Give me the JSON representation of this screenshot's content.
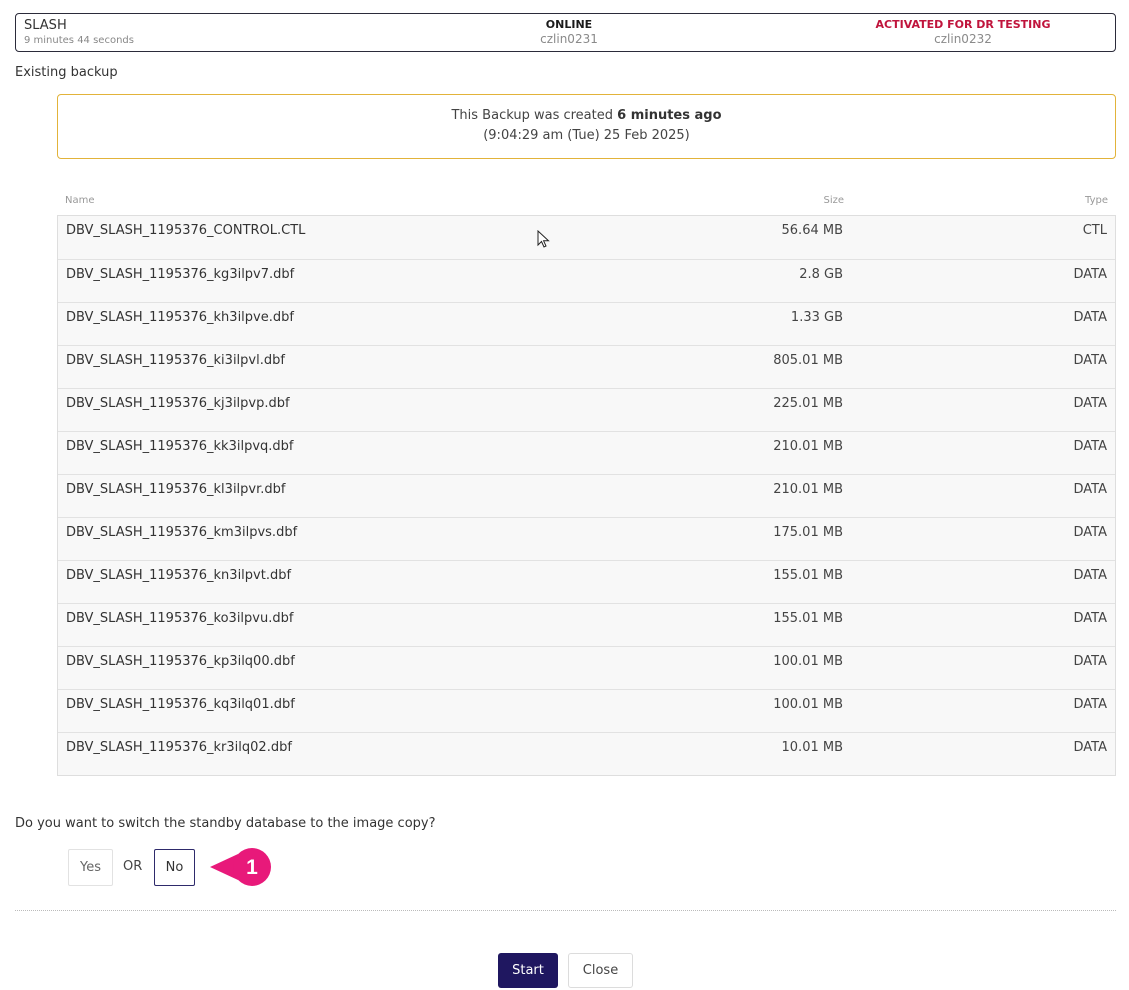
{
  "status": {
    "db_name": "SLASH",
    "elapsed": "9 minutes 44 seconds",
    "primary_status": "ONLINE",
    "primary_host": "czlin0231",
    "standby_status": "ACTIVATED FOR DR TESTING",
    "standby_host": "czlin0232"
  },
  "section_label": "Existing backup",
  "notice": {
    "prefix": "This Backup was created ",
    "age": "6 minutes ago",
    "timestamp": "(9:04:29 am  (Tue)  25 Feb 2025)"
  },
  "table": {
    "headers": {
      "name": "Name",
      "size": "Size",
      "type": "Type"
    },
    "rows": [
      {
        "name": "DBV_SLASH_1195376_CONTROL.CTL",
        "size": "56.64 MB",
        "type": "CTL"
      },
      {
        "name": "DBV_SLASH_1195376_kg3ilpv7.dbf",
        "size": "2.8 GB",
        "type": "DATA"
      },
      {
        "name": "DBV_SLASH_1195376_kh3ilpve.dbf",
        "size": "1.33 GB",
        "type": "DATA"
      },
      {
        "name": "DBV_SLASH_1195376_ki3ilpvl.dbf",
        "size": "805.01 MB",
        "type": "DATA"
      },
      {
        "name": "DBV_SLASH_1195376_kj3ilpvp.dbf",
        "size": "225.01 MB",
        "type": "DATA"
      },
      {
        "name": "DBV_SLASH_1195376_kk3ilpvq.dbf",
        "size": "210.01 MB",
        "type": "DATA"
      },
      {
        "name": "DBV_SLASH_1195376_kl3ilpvr.dbf",
        "size": "210.01 MB",
        "type": "DATA"
      },
      {
        "name": "DBV_SLASH_1195376_km3ilpvs.dbf",
        "size": "175.01 MB",
        "type": "DATA"
      },
      {
        "name": "DBV_SLASH_1195376_kn3ilpvt.dbf",
        "size": "155.01 MB",
        "type": "DATA"
      },
      {
        "name": "DBV_SLASH_1195376_ko3ilpvu.dbf",
        "size": "155.01 MB",
        "type": "DATA"
      },
      {
        "name": "DBV_SLASH_1195376_kp3ilq00.dbf",
        "size": "100.01 MB",
        "type": "DATA"
      },
      {
        "name": "DBV_SLASH_1195376_kq3ilq01.dbf",
        "size": "100.01 MB",
        "type": "DATA"
      },
      {
        "name": "DBV_SLASH_1195376_kr3ilq02.dbf",
        "size": "10.01 MB",
        "type": "DATA"
      }
    ]
  },
  "question": "Do you want to switch the standby database to the image copy?",
  "choice": {
    "yes_label": "Yes",
    "or_label": "OR",
    "no_label": "No"
  },
  "callout": {
    "number": "1",
    "color": "#e8197a"
  },
  "footer": {
    "start_label": "Start",
    "close_label": "Close"
  },
  "colors": {
    "accent": "#1f1760",
    "standby_status": "#c0143c",
    "notice_border": "#e2b33a"
  }
}
